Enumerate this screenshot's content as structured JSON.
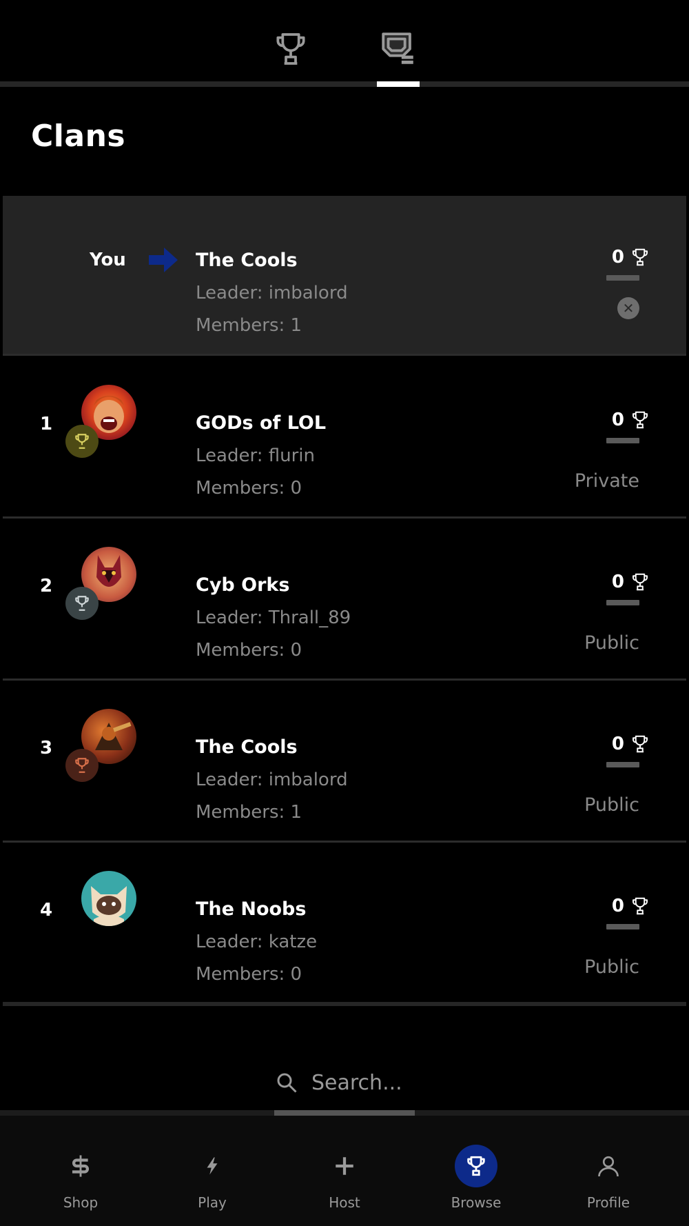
{
  "page": {
    "title": "Clans"
  },
  "top_tabs": [
    {
      "icon": "trophy-icon",
      "active": false
    },
    {
      "icon": "clan-board-icon",
      "active": true
    }
  ],
  "my_clan": {
    "you_label": "You",
    "name": "The Cools",
    "leader": "Leader: imbalord",
    "members": "Members: 1",
    "trophies": "0"
  },
  "clans": [
    {
      "rank": "1",
      "name": "GODs of LOL",
      "leader": "Leader: flurin",
      "members": "Members: 0",
      "trophies": "0",
      "privacy": "Private",
      "badge": "gold",
      "avatar": "barbarian"
    },
    {
      "rank": "2",
      "name": "Cyb Orks",
      "leader": "Leader: Thrall_89",
      "members": "Members: 0",
      "trophies": "0",
      "privacy": "Public",
      "badge": "silver",
      "avatar": "fox-mask"
    },
    {
      "rank": "3",
      "name": "The Cools",
      "leader": "Leader: imbalord",
      "members": "Members: 1",
      "trophies": "0",
      "privacy": "Public",
      "badge": "bronze",
      "avatar": "warrior"
    },
    {
      "rank": "4",
      "name": "The Noobs",
      "leader": "Leader: katze",
      "members": "Members: 0",
      "trophies": "0",
      "privacy": "Public",
      "badge": "none",
      "avatar": "cat"
    }
  ],
  "search": {
    "placeholder": "Search..."
  },
  "nav": {
    "items": [
      {
        "label": "Shop",
        "icon": "dollar-icon"
      },
      {
        "label": "Play",
        "icon": "bolt-icon"
      },
      {
        "label": "Host",
        "icon": "plus-icon"
      },
      {
        "label": "Browse",
        "icon": "trophy-icon"
      },
      {
        "label": "Profile",
        "icon": "person-icon"
      }
    ],
    "active": "Browse"
  },
  "colors": {
    "background": "#000000",
    "row_highlight": "#242424",
    "accent_blue": "#0d2a8a",
    "muted_text": "#8a8a8a",
    "gold_badge": "#4d4a14",
    "silver_badge": "#3a4446",
    "bronze_badge": "#4a2218"
  }
}
